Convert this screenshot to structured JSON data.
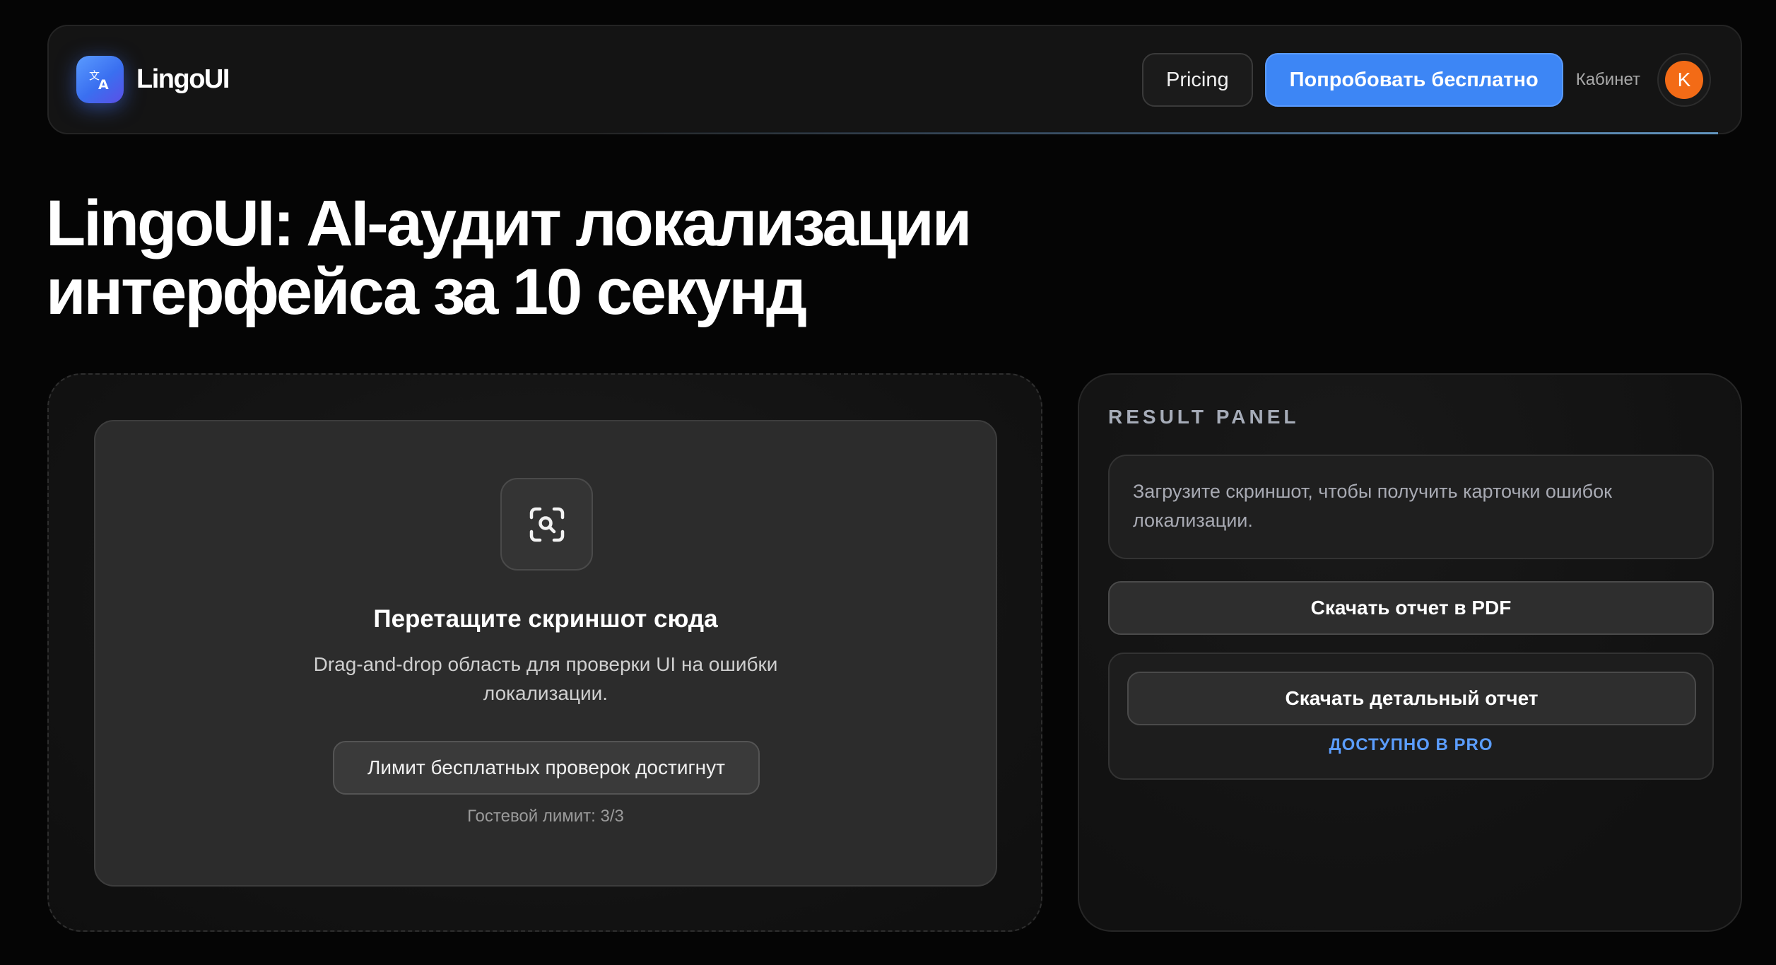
{
  "header": {
    "brand": "LingoUI",
    "pricing_label": "Pricing",
    "try_label": "Попробовать бесплатно",
    "cabinet_label": "Кабинет",
    "avatar_initial": "K",
    "logo_icon": "translate-icon"
  },
  "hero": {
    "title_line1": "LingoUI: AI-аудит локализации",
    "title_line2": "интерфейса за 10 секунд"
  },
  "upload": {
    "icon": "scan-search-icon",
    "title": "Перетащите скриншот сюда",
    "subtitle": "Drag-and-drop область для проверки UI на ошибки локализации.",
    "limit_label": "Лимит бесплатных проверок достигнут",
    "guest_limit": "Гостевой лимит: 3/3"
  },
  "result": {
    "title": "RESULT PANEL",
    "info": "Загрузите скриншот, чтобы получить карточки ошибок локализации.",
    "pdf_label": "Скачать отчет в PDF",
    "detail_label": "Скачать детальный отчет",
    "pro_label": "ДОСТУПНО В PRO"
  },
  "colors": {
    "accent": "#3d86f5",
    "pro_text": "#5b9dff",
    "avatar": "#f36b16",
    "background": "#050505"
  }
}
